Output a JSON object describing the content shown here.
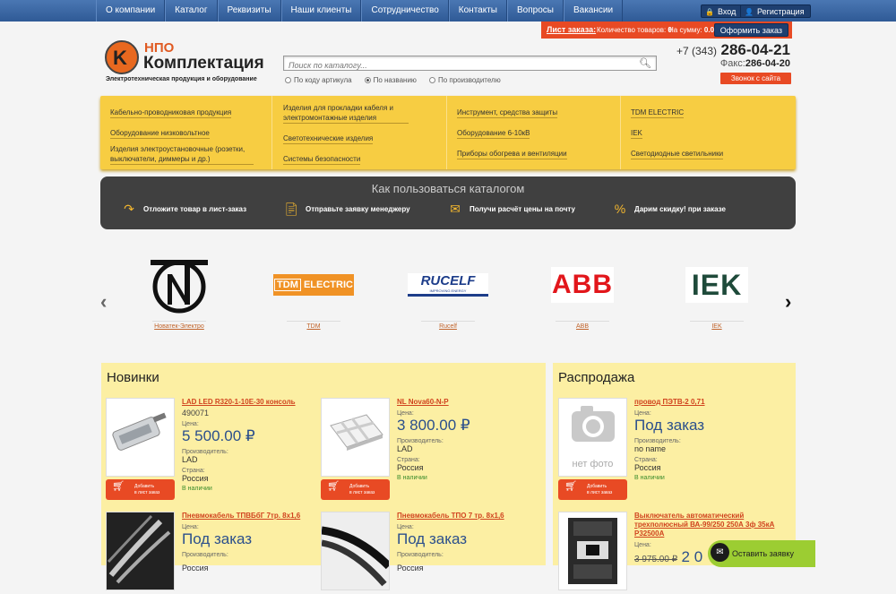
{
  "nav": {
    "items": [
      "О компании",
      "Каталог",
      "Реквизиты",
      "Наши клиенты",
      "Сотрудничество",
      "Контакты",
      "Вопросы",
      "Вакансии"
    ],
    "login": "Вход",
    "register": "Регистрация"
  },
  "order": {
    "label": "Лист заказа:",
    "qty_label": "Количество товаров:",
    "qty_value": "0",
    "sum_label": "На сумму:",
    "sum_value": "0.00 ₽",
    "button": "Оформить заказ"
  },
  "logo": {
    "letter": "K",
    "npo": "НПО",
    "name": "Комплектация",
    "slogan": "Электротехническая продукция и оборудование"
  },
  "search": {
    "placeholder": "Поиск по каталогу...",
    "options": [
      {
        "label": "По коду артикула",
        "selected": false
      },
      {
        "label": "По названию",
        "selected": true
      },
      {
        "label": "По производителю",
        "selected": false
      }
    ]
  },
  "contact": {
    "code": "+7 (343)",
    "phone": "286-04-21",
    "fax_label": "Факс:",
    "fax": "286-04-20",
    "callback": "Звонок с сайта"
  },
  "catalog": {
    "col1": [
      "Кабельно-проводниковая продукция",
      "Оборудование низковольтное",
      "Изделия электроустановочные (розетки, выключатели, диммеры и др.)"
    ],
    "col2": [
      "Изделия для прокладки кабеля и электромонтажные изделия",
      "Светотехнические изделия",
      "Системы безопасности"
    ],
    "col3": [
      "Инструмент, средства защиты",
      "Оборудование 6-10кВ",
      "Приборы обогрева и вентиляции"
    ],
    "col4": [
      "TDM ELECTRIC",
      "IEK",
      "Светодиодные светильники"
    ]
  },
  "howto": {
    "title": "Как пользоваться каталогом",
    "steps": [
      "Отложите товар в лист-заказ",
      "Отправьте заявку менеджеру",
      "Получи расчёт цены на почту",
      "Дарим скидку! при заказе"
    ]
  },
  "brands": {
    "items": [
      "Новатек-Электро",
      "TDM",
      "Rucelf",
      "ABB",
      "IEK"
    ],
    "logos": {
      "tdm_a": "TDM",
      "tdm_b": "ELECTRIC",
      "rucelf": "RUCELF",
      "rucelf_sub": "IMPROVING ENERGY",
      "abb": "ABB",
      "iek": "IEK"
    }
  },
  "novinki": {
    "title": "Новинки",
    "add_label_1": "Добавить",
    "add_label_2": "в лист заказ",
    "products": [
      {
        "name": "LAD LED R320-1-10E-30 консоль",
        "article": "490071",
        "price_label": "Цена:",
        "price": "5 500.00 ₽",
        "maker_label": "Производитель:",
        "maker": "LAD",
        "country_label": "Страна:",
        "country": "Россия",
        "stock": "В наличии"
      },
      {
        "name": "NL Nova60-N-P",
        "price_label": "Цена:",
        "price": "3 800.00 ₽",
        "maker_label": "Производитель:",
        "maker": "LAD",
        "country_label": "Страна:",
        "country": "Россия",
        "stock": "В наличии"
      },
      {
        "name": "Пневмокабель ТПВБбГ 7тр. 8х1,6",
        "price_label": "Цена:",
        "price": "Под заказ",
        "maker_label": "Производитель:",
        "country": "Россия"
      },
      {
        "name": "Пневмокабель ТПО 7 тр. 8х1,6",
        "price_label": "Цена:",
        "price": "Под заказ",
        "maker_label": "Производитель:",
        "country": "Россия"
      }
    ]
  },
  "sale": {
    "title": "Распродажа",
    "no_photo": "нет фото",
    "products": [
      {
        "name": "провод ПЭТВ-2 0,71",
        "price_label": "Цена:",
        "price": "Под заказ",
        "maker_label": "Производитель:",
        "maker": "no name",
        "country_label": "Страна:",
        "country": "Россия",
        "stock": "В наличии"
      },
      {
        "name": "Выключатель автоматический трехполюсный ВА-99/250 250А 3ф 35кА Р32500А",
        "price_label": "Цена:",
        "old_price": "3 975.00 ₽",
        "price": "2 0"
      }
    ]
  },
  "leave_request": "Оставить заявку"
}
